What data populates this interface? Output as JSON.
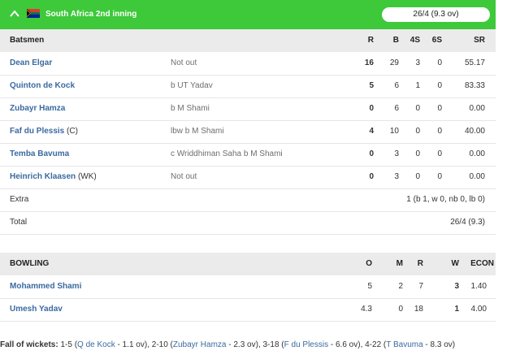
{
  "header": {
    "title": "South Africa 2nd inning",
    "score": "26/4 (9.3 ov)",
    "flag_colors": {
      "green": "#007a4d",
      "gold": "#ffb612",
      "red": "#de3831",
      "blue": "#002395",
      "black": "#000000"
    }
  },
  "batting": {
    "headers": {
      "name": "Batsmen",
      "r": "R",
      "b": "B",
      "fours": "4S",
      "sixes": "6S",
      "sr": "SR"
    },
    "rows": [
      {
        "name": "Dean Elgar",
        "role": "",
        "dismissal": "Not out",
        "r": "16",
        "b": "29",
        "fours": "3",
        "sixes": "0",
        "sr": "55.17"
      },
      {
        "name": "Quinton de Kock",
        "role": "",
        "dismissal": "b UT Yadav",
        "r": "5",
        "b": "6",
        "fours": "1",
        "sixes": "0",
        "sr": "83.33"
      },
      {
        "name": "Zubayr Hamza",
        "role": "",
        "dismissal": "b M Shami",
        "r": "0",
        "b": "6",
        "fours": "0",
        "sixes": "0",
        "sr": "0.00"
      },
      {
        "name": "Faf du Plessis",
        "role": "(C)",
        "dismissal": "lbw b M Shami",
        "r": "4",
        "b": "10",
        "fours": "0",
        "sixes": "0",
        "sr": "40.00"
      },
      {
        "name": "Temba Bavuma",
        "role": "",
        "dismissal": "c Wriddhiman Saha b M Shami",
        "r": "0",
        "b": "3",
        "fours": "0",
        "sixes": "0",
        "sr": "0.00"
      },
      {
        "name": "Heinrich Klaasen",
        "role": "(WK)",
        "dismissal": "Not out",
        "r": "0",
        "b": "3",
        "fours": "0",
        "sixes": "0",
        "sr": "0.00"
      }
    ],
    "extra": {
      "label": "Extra",
      "value": "1 (b 1, w 0, nb 0, lb 0)"
    },
    "total": {
      "label": "Total",
      "value": "26/4 (9.3)"
    }
  },
  "bowling": {
    "headers": {
      "name": "BOWLING",
      "o": "O",
      "m": "M",
      "r": "R",
      "w": "W",
      "econ": "ECON"
    },
    "rows": [
      {
        "name": "Mohammed Shami",
        "o": "5",
        "m": "2",
        "r": "7",
        "w": "3",
        "econ": "1.40"
      },
      {
        "name": "Umesh Yadav",
        "o": "4.3",
        "m": "0",
        "r": "18",
        "w": "1",
        "econ": "4.00"
      }
    ]
  },
  "fall_of_wickets": {
    "label": "Fall of wickets:",
    "items": [
      {
        "score": "1-5",
        "player": "Q de Kock",
        "over": "1.1 ov"
      },
      {
        "score": "2-10",
        "player": "Zubayr Hamza",
        "over": "2.3 ov"
      },
      {
        "score": "3-18",
        "player": "F du Plessis",
        "over": "6.6 ov"
      },
      {
        "score": "4-22",
        "player": "T Bavuma",
        "over": "8.3 ov"
      }
    ]
  }
}
